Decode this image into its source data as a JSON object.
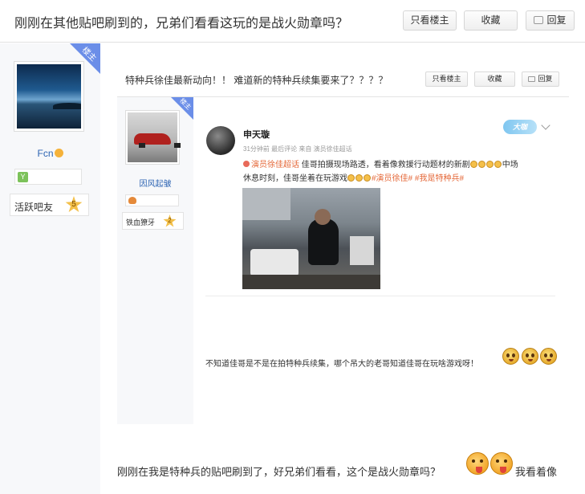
{
  "header": {
    "title": "刚刚在其他贴吧刷到的，兄弟们看看这玩的是战火勋章吗？",
    "buttons": {
      "only_op": "只看楼主",
      "favorite": "收藏",
      "reply": "回复"
    }
  },
  "author": {
    "corner_label": "楼主",
    "name": "Fcn",
    "level_title": "活跃吧友",
    "level": "5"
  },
  "embedded_post": {
    "title": "特种兵徐佳最新动向！！ 难道新的特种兵续集要来了？？？？",
    "buttons": {
      "only_op": "只看楼主",
      "favorite": "收藏",
      "reply": "回复"
    },
    "author": {
      "corner_label": "楼主",
      "name": "因风起皱",
      "level_title": "铁血獠牙",
      "level": "2"
    },
    "weibo": {
      "name": "申天璇",
      "meta": "31分钟前  最后评论  来自 演员徐佳超话",
      "badge": "大咖",
      "line1_tag": "演员徐佳超话",
      "line1_text": "佳哥拍摄现场路透，看着像救援行动题材的新剧",
      "line1_tail": "中场",
      "line2_text": "休息时刻，佳哥坐着在玩游戏",
      "line2_tags": "#演员徐佳# #我是特种兵#"
    },
    "reply_text": "不知道佳哥是不是在拍特种兵续集，哪个吊大的老哥知道佳哥在玩啥游戏呀！"
  },
  "post": {
    "text": "刚刚在我是特种兵的贴吧刷到了，好兄弟们看看，这个是战火勋章吗？",
    "tail": "我看着像"
  },
  "colors": {
    "accent_blue": "#6b8ee8",
    "link_blue": "#2d64b3",
    "tag_orange": "#e5693a",
    "sidebar_bg": "#f7f8fa"
  }
}
